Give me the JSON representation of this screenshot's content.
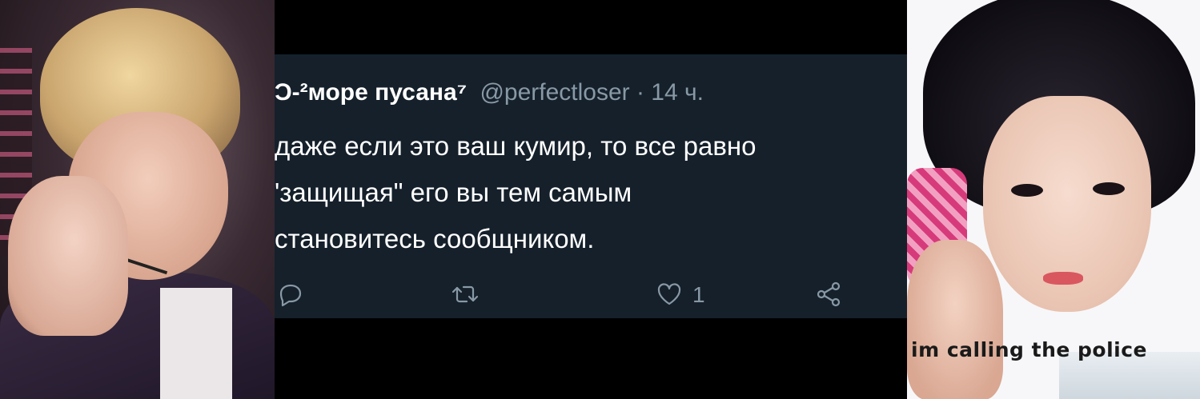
{
  "left_photo": {
    "description_icon": "person-photo"
  },
  "tweet": {
    "display_name": "Ͻ-²море пусана⁷",
    "meta": "@perfectloser · 14 ч.",
    "body_lines": [
      "даже если это ваш кумир, то все равно",
      "'защищая\" его вы тем самым",
      "становитесь сообщником."
    ],
    "like_count": "1",
    "colors": {
      "background": "#15202b",
      "text": "#ffffff",
      "muted": "#8899a6"
    },
    "actions": [
      "reply-icon",
      "retweet-icon",
      "like-icon",
      "share-icon"
    ]
  },
  "right_photo": {
    "caption": "im calling the police"
  }
}
